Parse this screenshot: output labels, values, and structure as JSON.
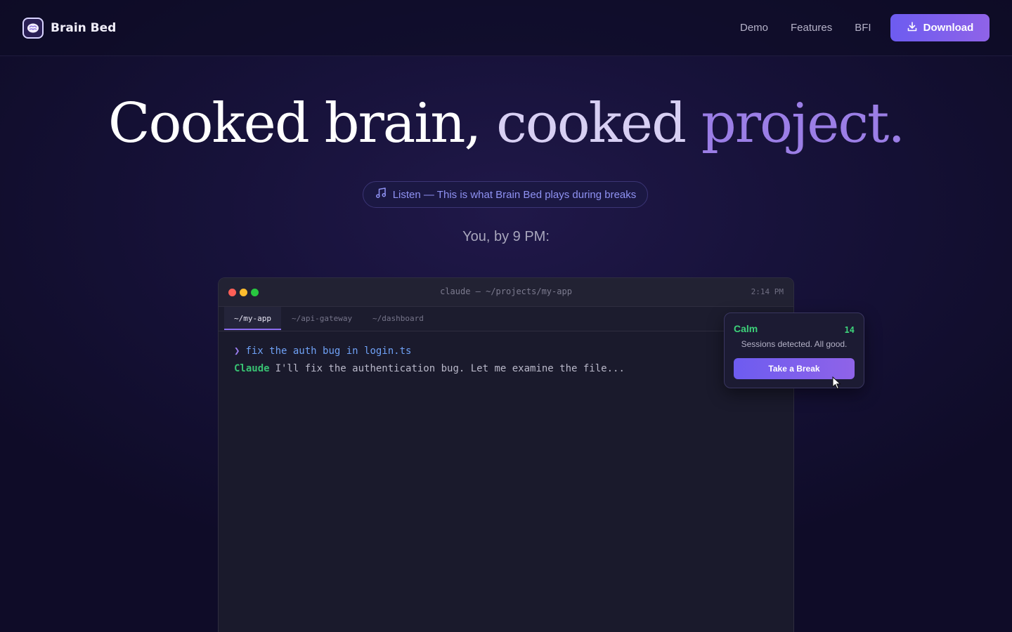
{
  "nav": {
    "brand_name": "Brain Bed",
    "links": [
      "Demo",
      "Features",
      "BFI"
    ],
    "download_label": "Download"
  },
  "hero": {
    "title_part1": "Cooked brain,",
    "title_part2": "cooked",
    "title_part3": "project.",
    "listen_label": "Listen — This is what Brain Bed plays during breaks",
    "subtitle": "You, by 9 PM:"
  },
  "terminal": {
    "title": "claude — ~/projects/my-app",
    "clock": "2:14 PM",
    "tabs": [
      "~/my-app",
      "~/api-gateway",
      "~/dashboard"
    ],
    "active_tab": "~/my-app",
    "prompt_symbol": "❯",
    "command": "fix the auth bug in login.ts",
    "response_label": "Claude",
    "response_text": "I'll fix the authentication bug. Let me examine the file..."
  },
  "popup": {
    "status": "Calm",
    "count": "14",
    "message": "Sessions detected. All good.",
    "button_label": "Take a Break"
  },
  "colors": {
    "background": "#0f0c28",
    "accent": "#7b5ff0",
    "calm_green": "#3dd27a",
    "command_blue": "#6fa1f5"
  }
}
